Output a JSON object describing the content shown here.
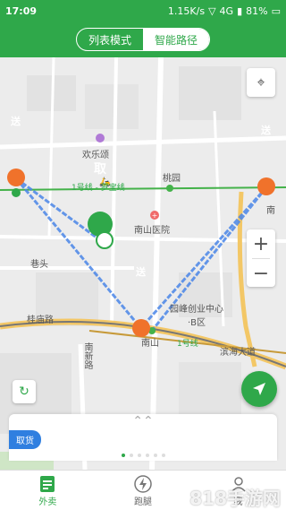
{
  "status_bar": {
    "time": "17:09",
    "speed": "1.15K/s",
    "network": "4G",
    "battery": "81%"
  },
  "header": {
    "tabs": [
      {
        "label": "列表模式",
        "active": false
      },
      {
        "label": "智能路径",
        "active": true
      }
    ]
  },
  "map": {
    "labels": {
      "huanlesong": "欢乐颂",
      "taoyuan": "桃园",
      "nanshan_hospital": "南山医院",
      "line1_top": "1号线 - 罗宝线",
      "xiangtou": "巷头",
      "kechuang": "园峰创业中心·B区",
      "guimiao_road": "桂庙路",
      "nanshan": "南山",
      "line1_bottom": "1号线",
      "binhai": "滨海大道",
      "nanxin_road": "南新路",
      "nan_partial": "南"
    },
    "markers": {
      "pickup": "取",
      "deliver": "送"
    },
    "route_color": "#4a86e8",
    "accent_color": "#2fa84a",
    "deliver_color": "#f0722b"
  },
  "sheet": {
    "badge": "取货",
    "page_count": 6,
    "active_page": 1
  },
  "nav": {
    "items": [
      {
        "label": "外卖",
        "icon": "list-icon",
        "active": true
      },
      {
        "label": "跑腿",
        "icon": "bolt-icon",
        "active": false
      },
      {
        "label": "我",
        "icon": "user-icon",
        "active": false
      }
    ]
  },
  "watermark": "818手游网"
}
